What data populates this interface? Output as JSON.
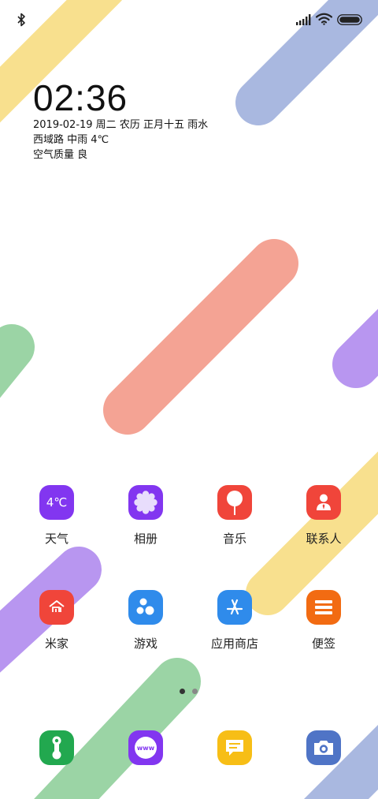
{
  "status_bar": {
    "left_icon": "bluetooth-icon",
    "right_icons": [
      "signal-icon",
      "wifi-icon",
      "battery-icon"
    ]
  },
  "clock_widget": {
    "time": "02:36",
    "date_line": "2019-02-19 周二 农历 正月十五 雨水",
    "weather_line": "西域路 中雨 4℃",
    "air_quality_line": "空气质量 良"
  },
  "apps": [
    {
      "label": "天气",
      "icon": "weather-icon",
      "icon_text": "4℃",
      "color": "#8236F0"
    },
    {
      "label": "相册",
      "icon": "gallery-icon",
      "color": "#8236F0"
    },
    {
      "label": "音乐",
      "icon": "music-icon",
      "color": "#F0453A"
    },
    {
      "label": "联系人",
      "icon": "contacts-icon",
      "color": "#F0453A"
    },
    {
      "label": "米家",
      "icon": "mijia-icon",
      "color": "#F0453A"
    },
    {
      "label": "游戏",
      "icon": "games-icon",
      "color": "#2F8BEB"
    },
    {
      "label": "应用商店",
      "icon": "app-store-icon",
      "color": "#2F8BEB"
    },
    {
      "label": "便签",
      "icon": "notes-icon",
      "color": "#F26B12"
    }
  ],
  "page_indicator": {
    "count": 2,
    "active": 0
  },
  "dock": [
    {
      "icon": "phone-icon",
      "color": "#22A84F"
    },
    {
      "icon": "browser-icon",
      "icon_text": "www",
      "color": "#8236F0"
    },
    {
      "icon": "messages-icon",
      "color": "#F7BE16"
    },
    {
      "icon": "camera-icon",
      "color": "#4F74C6"
    }
  ],
  "wallpaper_colors": {
    "yellow": "#F8E08E",
    "blue": "#A9B8E0",
    "salmon": "#F4A394",
    "green": "#9BD4A5",
    "purple": "#B896F0"
  }
}
